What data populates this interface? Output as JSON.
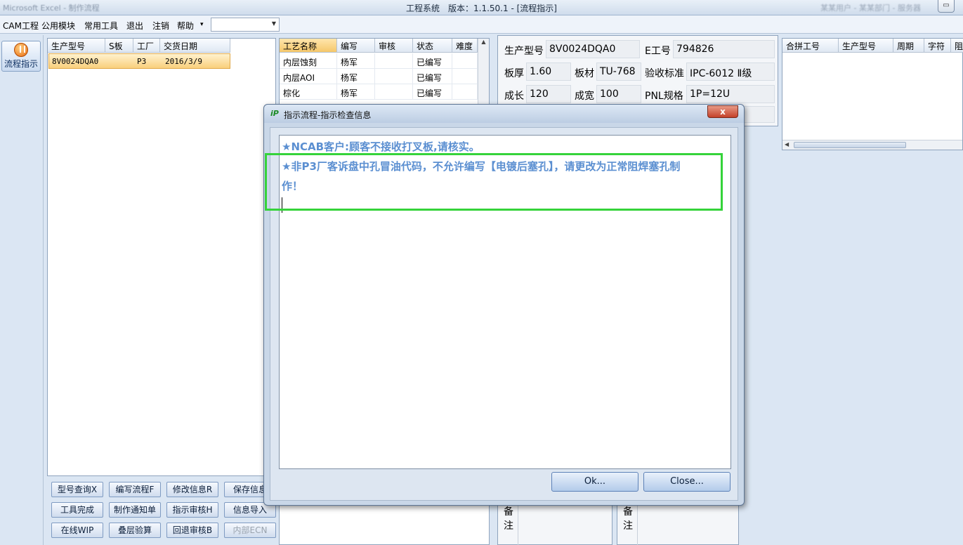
{
  "window": {
    "app_title": "Microsoft Excel - 制作流程",
    "title": "工程系统　版本：1.1.50.1 - [流程指示]",
    "right_blur": "某某用户 - 某某部门 - 服务器"
  },
  "menu": {
    "items": [
      "CAM工程",
      "公用模块",
      "常用工具",
      "退出",
      "注销",
      "帮助"
    ],
    "help_arrow": "▾",
    "combo_value": ""
  },
  "sidebar": {
    "flow_button": "流程指示"
  },
  "order_grid": {
    "headers": [
      "生产型号",
      "S板",
      "工厂",
      "交货日期"
    ],
    "rows": [
      [
        "8V0024DQA0",
        "",
        "P3",
        "2016/3/9"
      ]
    ]
  },
  "process_grid": {
    "headers": [
      "工艺名称",
      "编写",
      "审核",
      "状态",
      "难度"
    ],
    "rows": [
      [
        "内层蚀刻",
        "杨军",
        "",
        "已编写",
        ""
      ],
      [
        "内层AOI",
        "杨军",
        "",
        "已编写",
        ""
      ],
      [
        "棕化",
        "杨军",
        "",
        "已编写",
        ""
      ]
    ]
  },
  "info": {
    "model_label": "生产型号",
    "model_value": "8V0024DQA0",
    "e_label": "E工号",
    "e_value": "794826",
    "thickness_label": "板厚",
    "thickness_value": "1.60",
    "material_label": "板材",
    "material_value": "TU-768",
    "standard_label": "验收标准",
    "standard_value": "IPC-6012 Ⅱ级",
    "length_label": "成长",
    "length_value": "120",
    "width_label": "成宽",
    "width_value": "100",
    "pnl_label": "PNL规格",
    "pnl_value": "1P=12U"
  },
  "merge_grid": {
    "headers": [
      "合拼工号",
      "生产型号",
      "周期",
      "字符",
      "阻"
    ]
  },
  "buttons": {
    "row1": [
      "型号查询X",
      "编写流程F",
      "修改信息R",
      "保存信息"
    ],
    "row2": [
      "工具完成",
      "制作通知单",
      "指示审核H",
      "信息导入"
    ],
    "row3": [
      "在线WIP",
      "叠层验算",
      "回退审核B",
      "内部ECN"
    ]
  },
  "remark": {
    "label_left": "备注",
    "label_right": "备注"
  },
  "dialog": {
    "title": "指示流程-指示检查信息",
    "close_symbol": "x",
    "messages": [
      "★NCAB客户:顾客不接收打叉板,请核实。",
      "★非P3厂客诉盘中孔冒油代码，不允许编写【电镀后塞孔】，请更改为正常阻焊塞孔制",
      "作！"
    ],
    "ok_label": "Ok...",
    "close_label": "Close..."
  }
}
